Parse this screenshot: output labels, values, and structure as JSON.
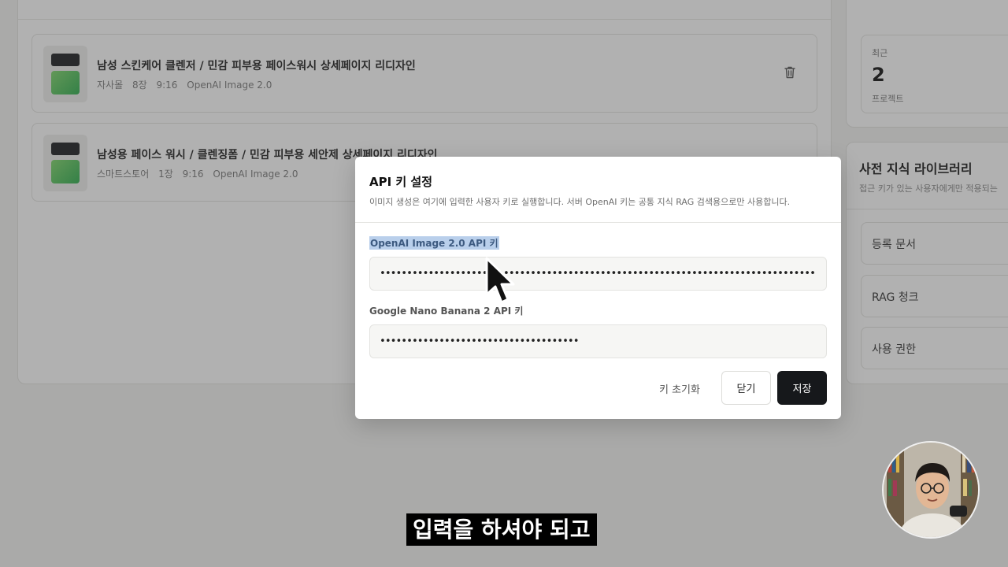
{
  "projects": [
    {
      "title": "남성 스킨케어 클렌저 / 민감 피부용 페이스워시 상세페이지 리디자인",
      "meta": [
        "자사몰",
        "8장",
        "9:16",
        "OpenAI Image 2.0"
      ]
    },
    {
      "title": "남성용 페이스 워시 / 클렌징폼 / 민감 피부용 세안제 상세페이지 리디자인",
      "meta": [
        "스마트스토어",
        "1장",
        "9:16",
        "OpenAI Image 2.0"
      ]
    }
  ],
  "stats": {
    "label": "최근",
    "value": "2",
    "unit": "프로젝트"
  },
  "library": {
    "title": "사전 지식 라이브러리",
    "subtitle": "접근 키가 있는 사용자에게만 적용되는",
    "items": [
      "등록 문서",
      "RAG 청크",
      "사용 권한"
    ]
  },
  "modal": {
    "title": "API 키 설정",
    "description": "이미지 생성은 여기에 입력한 사용자 키로 실행합니다. 서버 OpenAI 키는 공통 지식 RAG 검색용으로만 사용합니다.",
    "openai_label": "OpenAI Image 2.0 API 키",
    "openai_value": "••••••••••••••••••••••••••••••••••••••••••••••••••••••••••••••••••••••••••••••••••••••••••••••••",
    "google_label": "Google Nano Banana 2 API 키",
    "google_value": "•••••••••••••••••••••••••••••••••••••",
    "reset_label": "키 초기화",
    "close_label": "닫기",
    "save_label": "저장"
  },
  "subtitle": "입력을 하셔야 되고"
}
